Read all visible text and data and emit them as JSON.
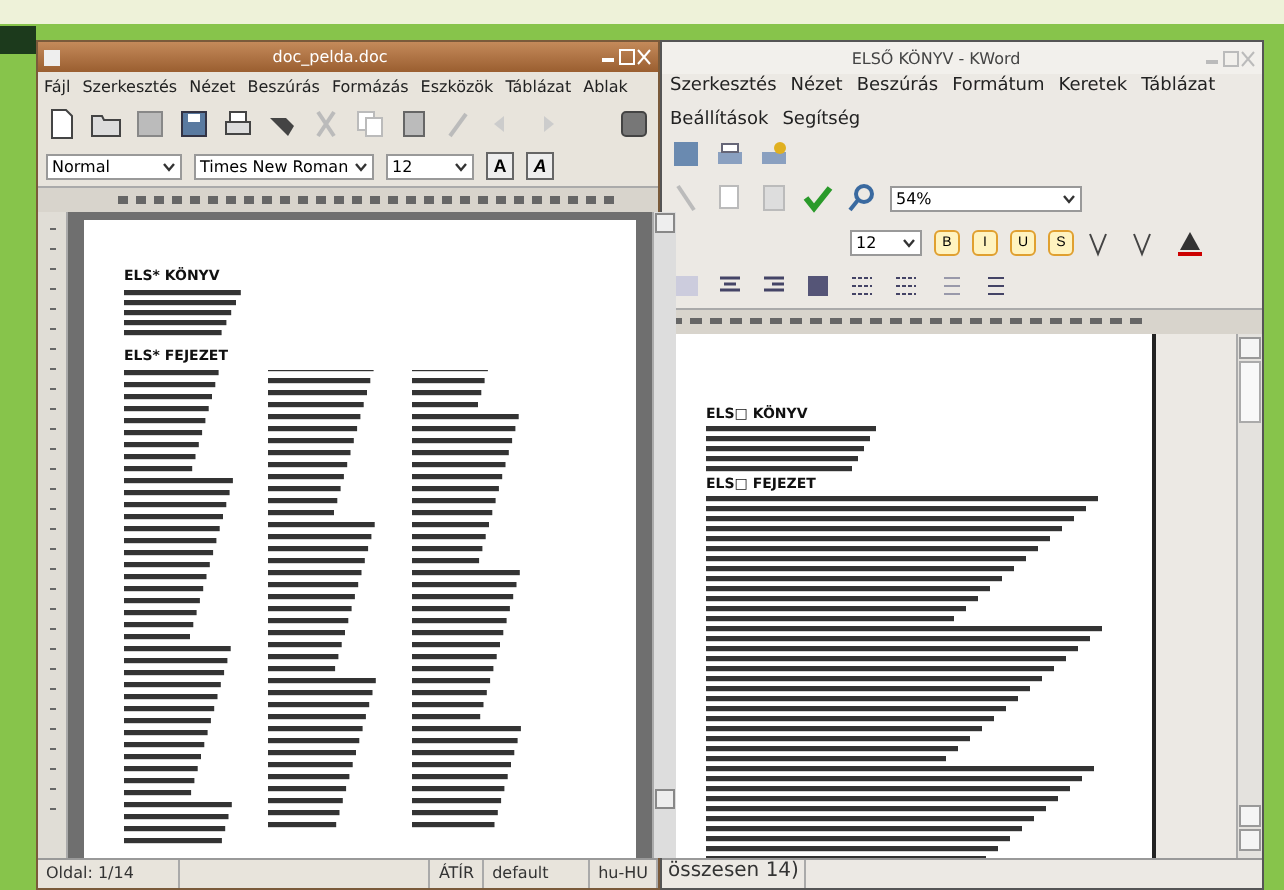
{
  "left_window": {
    "title": "doc_pelda.doc",
    "menu": [
      "Fájl",
      "Szerkesztés",
      "Nézet",
      "Beszúrás",
      "Formázás",
      "Eszközök",
      "Táblázat",
      "Ablak"
    ],
    "style_field": {
      "value": "Normal"
    },
    "font_field": {
      "value": "Times New Roman"
    },
    "size_field": {
      "value": "12"
    },
    "format_buttons": [
      "A",
      "A"
    ],
    "document": {
      "title": "ELS* KÖNYV",
      "chapter": "ELS* FEJEZET"
    },
    "status_bar": {
      "page": "Oldal: 1/14",
      "mode": "ÁTÍR",
      "style": "default",
      "language": "hu-HU"
    }
  },
  "right_window": {
    "title": "ELSŐ KÖNYV - KWord",
    "menu": [
      "Szerkesztés",
      "Nézet",
      "Beszúrás",
      "Formátum",
      "Keretek",
      "Táblázat",
      "Beállítások",
      "Segítség"
    ],
    "zoom_field": {
      "value": "54%"
    },
    "size_field": {
      "value": "12"
    },
    "format_buttons": [
      "B",
      "I",
      "U",
      "S"
    ],
    "document": {
      "title": "ELS□ KÖNYV",
      "chapter": "ELS□ FEJEZET"
    },
    "status_bar": {
      "text": "összesen 14)"
    }
  }
}
